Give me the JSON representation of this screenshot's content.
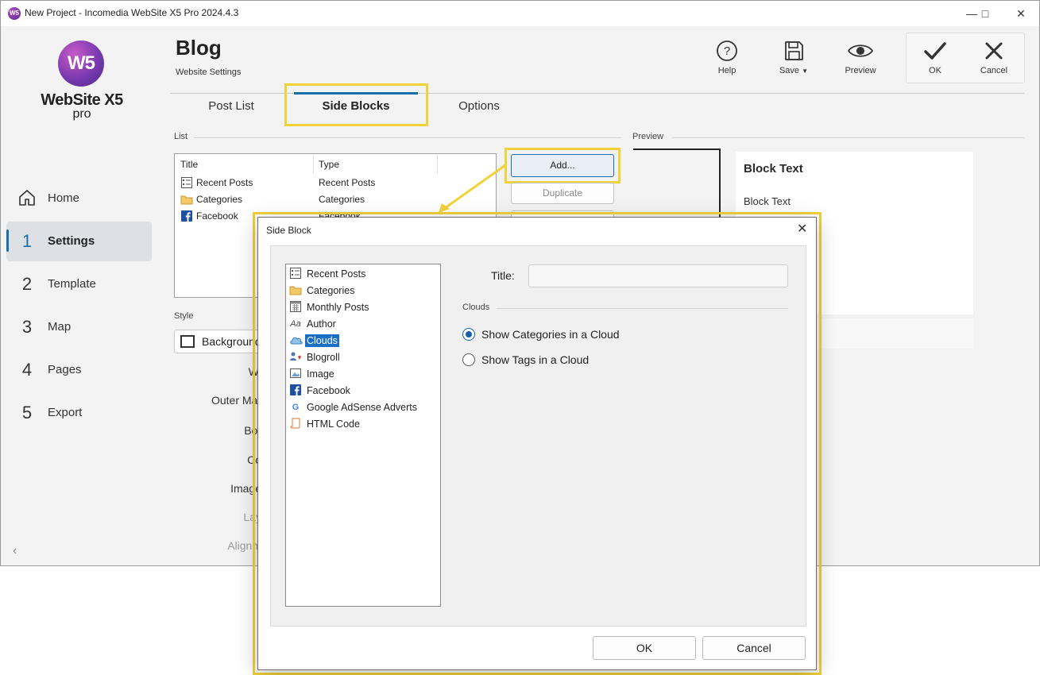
{
  "window": {
    "title": "New Project - Incomedia WebSite X5 Pro 2024.4.3",
    "icon_text": "W5"
  },
  "logo": {
    "mark": "W5",
    "name": "WebSite X5",
    "edition": "pro"
  },
  "nav": [
    {
      "num": "",
      "label": "Home"
    },
    {
      "num": "1",
      "label": "Settings"
    },
    {
      "num": "2",
      "label": "Template"
    },
    {
      "num": "3",
      "label": "Map"
    },
    {
      "num": "4",
      "label": "Pages"
    },
    {
      "num": "5",
      "label": "Export"
    }
  ],
  "header": {
    "title": "Blog",
    "subtitle": "Website Settings"
  },
  "toolbar": {
    "help": "Help",
    "save": "Save",
    "preview": "Preview",
    "ok": "OK",
    "cancel": "Cancel"
  },
  "tabs": [
    "Post List",
    "Side Blocks",
    "Options"
  ],
  "list_section": {
    "label": "List",
    "columns": [
      "Title",
      "Type"
    ],
    "rows": [
      {
        "title": "Recent Posts",
        "type": "Recent Posts"
      },
      {
        "title": "Categories",
        "type": "Categories"
      },
      {
        "title": "Facebook",
        "type": "Facebook"
      }
    ],
    "buttons": {
      "add": "Add...",
      "duplicate": "Duplicate"
    }
  },
  "style_section": {
    "label": "Style",
    "background_value": "Background",
    "labels": [
      "Wi",
      "Outer Mar",
      "Bor",
      "Co",
      "Image",
      "Lay",
      "Alignm"
    ]
  },
  "preview": {
    "label": "Preview",
    "block_title": "Block Text",
    "block_text": "Block Text"
  },
  "dialog": {
    "title": "Side Block",
    "types": [
      "Recent Posts",
      "Categories",
      "Monthly Posts",
      "Author",
      "Clouds",
      "Blogroll",
      "Image",
      "Facebook",
      "Google AdSense Adverts",
      "HTML Code"
    ],
    "selected_index": 4,
    "title_label": "Title:",
    "title_value": "",
    "clouds_label": "Clouds",
    "options": [
      "Show Categories in a Cloud",
      "Show Tags in a Cloud"
    ],
    "selected_option": 0,
    "ok": "OK",
    "cancel": "Cancel"
  },
  "colors": {
    "accent": "#1b6fa8",
    "highlight": "#f2d23a",
    "selection": "#1a6fc4"
  }
}
